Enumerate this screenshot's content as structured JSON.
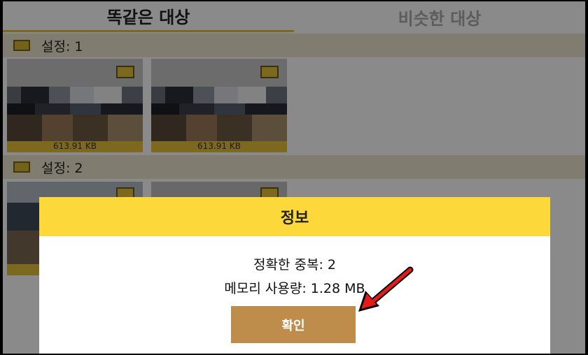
{
  "tabs": {
    "identical": "똑같은 대상",
    "similar": "비슷한 대상"
  },
  "groups": [
    {
      "label": "설정: 1",
      "items": [
        {
          "size": "613.91 KB"
        },
        {
          "size": "613.91 KB"
        }
      ]
    },
    {
      "label": "설정: 2",
      "items": [
        {},
        {}
      ]
    }
  ],
  "dialog": {
    "title": "정보",
    "exact_duplicates": "정확한 중복:  2",
    "memory_usage": "메모리 사용량:  1.28 MB",
    "ok_label": "확인"
  },
  "colors": {
    "accent_yellow": "#fdd83b",
    "ok_button": "#bf8d4b",
    "group_header": "#ece5cf",
    "annotation_arrow": "#e31b1b"
  }
}
